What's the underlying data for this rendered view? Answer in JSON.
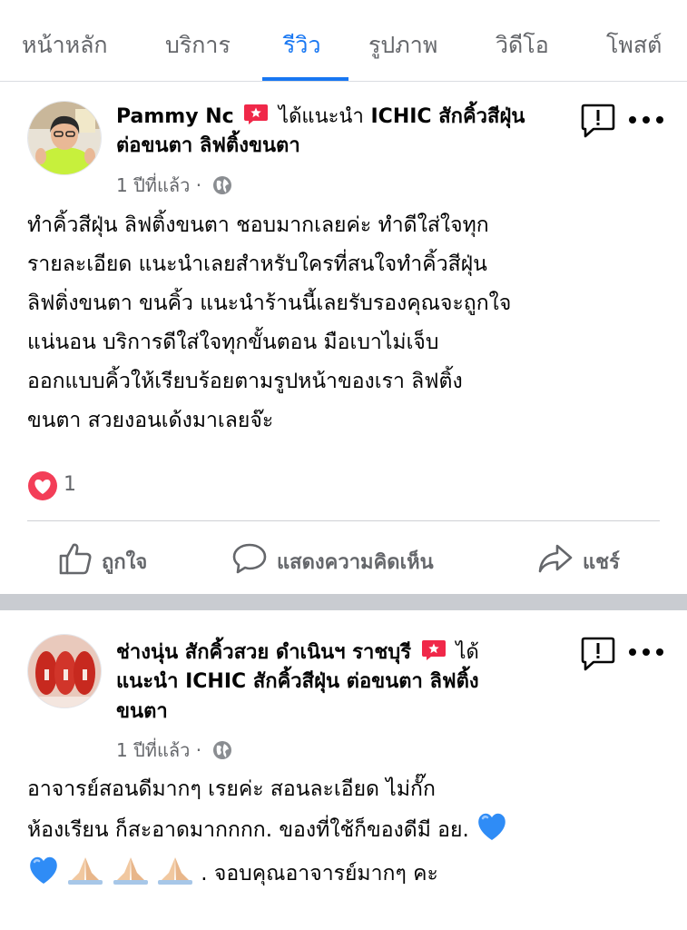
{
  "tabs": [
    {
      "label": "หน้าหลัก",
      "active": false
    },
    {
      "label": "บริการ",
      "active": false
    },
    {
      "label": "รีวิว",
      "active": true
    },
    {
      "label": "รูปภาพ",
      "active": false
    },
    {
      "label": "วิดีโอ",
      "active": false
    },
    {
      "label": "โพสต์",
      "active": false
    }
  ],
  "reviews": [
    {
      "author": "Pammy Nc",
      "recommend_text": "ได้แนะนำ",
      "page_name_line1": "ICHIC สักคิ้วสีฝุ่น",
      "page_name_line2": "ต่อขนตา ลิฟติ้งขนตา",
      "time": "1 ปีที่แล้ว",
      "body": [
        "ทำคิ้วสีฝุ่น ลิฟติ้งขนตา ชอบมากเลยค่ะ ทำดีใส่ใจทุก",
        "รายละเอียด แนะนำเลยสำหรับใครที่สนใจทำคิ้วสีฝุ่น",
        "ลิฟติ่งขนตา ขนคิ้ว แนะนำร้านนี้เลยรับรองคุณจะถูกใจ",
        "แน่นอน บริการดีใส่ใจทุกขั้นตอน มือเบาไม่เจ็บ",
        "ออกแบบคิ้วให้เรียบร้อยตามรูปหน้าของเรา ลิฟติ้ง",
        "ขนตา สวยงอนเด้งมาเลยจ๊ะ"
      ],
      "reaction_count": "1",
      "actions": {
        "like": "ถูกใจ",
        "comment": "แสดงความคิดเห็น",
        "share": "แชร์"
      }
    },
    {
      "author": "ช่างนุ่น สักคิ้วสวย ดำเนินฯ ราชบุรี",
      "recommend_text": "ได้",
      "head_line2": "แนะนำ ICHIC สักคิ้วสีฝุ่น ต่อขนตา ลิฟติ้ง",
      "head_line3": "ขนตา",
      "time": "1 ปีที่แล้ว",
      "body": [
        "อาจารย์สอนดีมากๆ เรยค่ะ สอนละเอียด ไม่กั๊ก",
        "ห้องเรียน ก็สะอาดมากกกก.  ของที่ใช้ก็ของดีมี อย.",
        ". จอบคุณอาจารย์มากๆ คะ"
      ]
    }
  ],
  "colors": {
    "accent": "#1877f2",
    "recommend_badge": "#f02849",
    "heart": "#f33e58",
    "blue_heart": "#2f8cf6"
  },
  "icons": {
    "recommend": "recommend-icon",
    "globe": "globe-icon",
    "report": "report-icon",
    "more": "more-icon",
    "like": "thumbs-up-icon",
    "comment": "comment-icon",
    "share": "share-icon",
    "heart_reaction": "heart-icon",
    "blue_heart": "blue-heart-emoji",
    "pray": "pray-emoji"
  }
}
